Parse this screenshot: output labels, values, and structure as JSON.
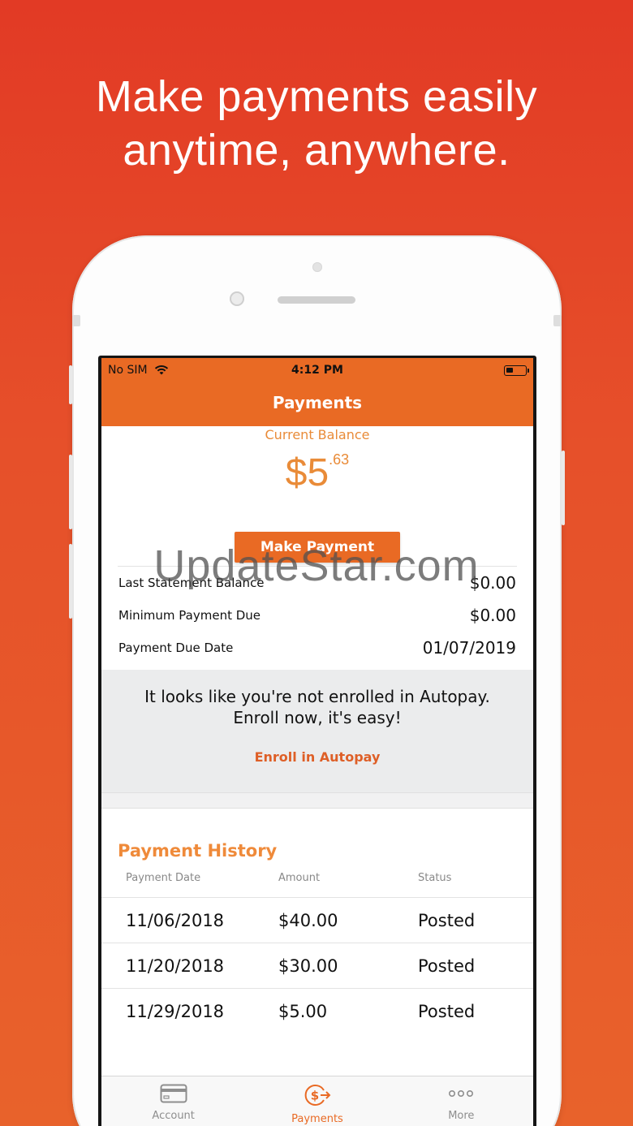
{
  "headline": {
    "line1": "Make payments easily",
    "line2": "anytime, anywhere."
  },
  "status_bar": {
    "carrier": "No SIM",
    "time": "4:12 PM"
  },
  "nav": {
    "title": "Payments"
  },
  "balance": {
    "label": "Current Balance",
    "dollars": "$5",
    "cents": ".63"
  },
  "make_payment_label": "Make Payment",
  "summary": [
    {
      "label": "Last Statement Balance",
      "value": "$0.00"
    },
    {
      "label": "Minimum Payment Due",
      "value": "$0.00"
    },
    {
      "label": "Payment Due Date",
      "value": "01/07/2019"
    }
  ],
  "autopay": {
    "message": "It looks like you're not enrolled in Autopay. Enroll now, it's easy!",
    "link": "Enroll in Autopay"
  },
  "history": {
    "title": "Payment History",
    "columns": [
      "Payment Date",
      "Amount",
      "Status"
    ],
    "rows": [
      {
        "date": "11/06/2018",
        "amount": "$40.00",
        "status": "Posted"
      },
      {
        "date": "11/20/2018",
        "amount": "$30.00",
        "status": "Posted"
      },
      {
        "date": "11/29/2018",
        "amount": "$5.00",
        "status": "Posted"
      }
    ]
  },
  "tabs": [
    {
      "label": "Account",
      "icon": "credit-card-icon"
    },
    {
      "label": "Payments",
      "icon": "payment-icon",
      "active": true
    },
    {
      "label": "More",
      "icon": "more-dots-icon"
    }
  ],
  "watermark": "UpdateStar.com",
  "colors": {
    "accent": "#e96a24",
    "background": "#e4452a",
    "history_title": "#ef8a3a"
  }
}
